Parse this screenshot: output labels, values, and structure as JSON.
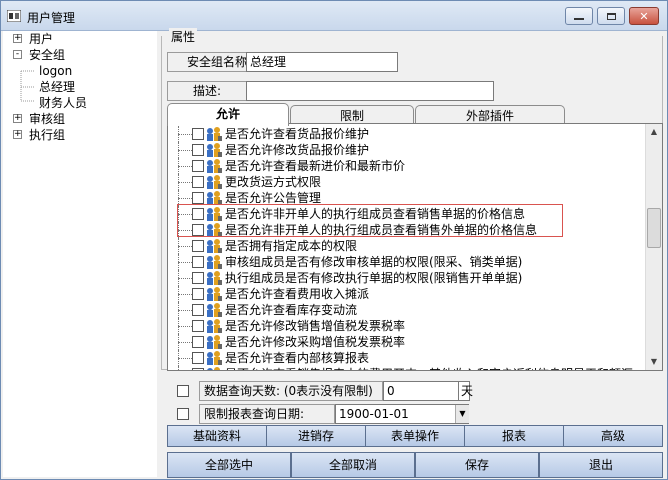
{
  "window": {
    "title": "用户管理"
  },
  "colors": {
    "highlight": "#d9534f",
    "titlebar": "#c9d8ec",
    "button": "#b6c9e6"
  },
  "tree": {
    "nodes": [
      {
        "label": "用户",
        "level": 0,
        "expander": "+"
      },
      {
        "label": "安全组",
        "level": 0,
        "expander": "-"
      },
      {
        "label": "logon",
        "level": 1
      },
      {
        "label": "总经理",
        "level": 1
      },
      {
        "label": "财务人员",
        "level": 1
      },
      {
        "label": "审核组",
        "level": 0,
        "expander": "+"
      },
      {
        "label": "执行组",
        "level": 0,
        "expander": "+"
      }
    ]
  },
  "properties": {
    "legend": "属性",
    "group_name_label": "安全组名称:",
    "group_name_value": "总经理",
    "description_label": "描述:",
    "description_value": ""
  },
  "tabs": [
    {
      "label": "允许",
      "active": true
    },
    {
      "label": "限制",
      "active": false
    },
    {
      "label": "外部插件",
      "active": false
    }
  ],
  "permissions": [
    "是否允许查看货品报价维护",
    "是否允许修改货品报价维护",
    "是否允许查看最新进价和最新市价",
    "更改货运方式权限",
    "是否允许公告管理",
    "是否允许非开单人的执行组成员查看销售单据的价格信息",
    "是否允许非开单人的执行组成员查看销售外单据的价格信息",
    "是否拥有指定成本的权限",
    "审核组成员是否有修改审核单据的权限(限采、销类单据)",
    "执行组成员是否有修改执行单据的权限(限销售开单单据)",
    "是否允许查看费用收入摊派",
    "是否允许查看库存变动流",
    "是否允许修改销售增值税发票税率",
    "是否允许修改采购增值税发票税率",
    "是否允许查看内部核算报表",
    "是否允许查看销售报表中的费用开支、其他收入和客户返利信息明显王和额汇"
  ],
  "options": {
    "query_days_label": "数据查询天数: (0表示没有限制)",
    "query_days_value": "0",
    "query_days_unit": "天",
    "report_date_label": "限制报表查询日期:",
    "report_date_value": "1900-01-01"
  },
  "category_buttons": [
    "基础资料",
    "进销存",
    "表单操作",
    "报表",
    "高级"
  ],
  "action_buttons": [
    "全部选中",
    "全部取消",
    "保存",
    "退出"
  ]
}
